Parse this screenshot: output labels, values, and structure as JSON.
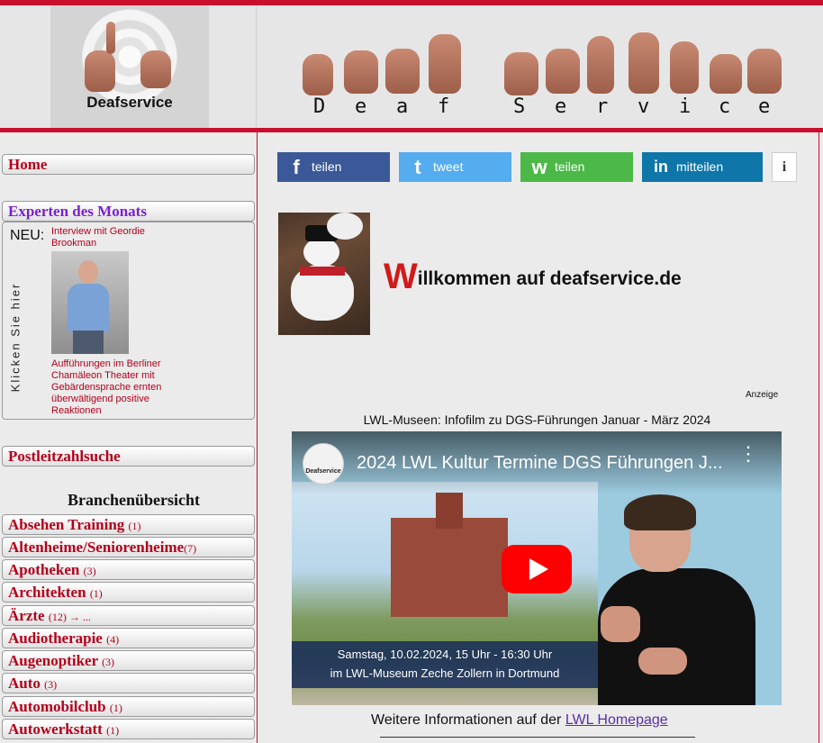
{
  "header": {
    "logo_text": "Deafservice",
    "banner_letters": [
      "D",
      "e",
      "a",
      "f",
      "S",
      "e",
      "r",
      "v",
      "i",
      "c",
      "e"
    ]
  },
  "sidebar": {
    "home": "Home",
    "experten": "Experten des Monats",
    "neu_label": "NEU:",
    "interview": "Interview mit Geordie Brookman",
    "klicken": "Klicken Sie hier",
    "news": "Aufführungen im Berliner Chamäleon Theater mit Gebärdensprache ernten überwältigend positive Reaktionen",
    "plz": "Postleitzahlsuche",
    "branchen_title": "Branchenübersicht",
    "categories": [
      {
        "label": "Absehen Training",
        "count": "(1)"
      },
      {
        "label": "Altenheime/Seniorenheime",
        "count": "(7)"
      },
      {
        "label": "Apotheken",
        "count": "(3)"
      },
      {
        "label": "Architekten",
        "count": "(1)"
      },
      {
        "label": "Ärzte",
        "count": "(12) → ..."
      },
      {
        "label": "Audiotherapie",
        "count": "(4)"
      },
      {
        "label": "Augenoptiker",
        "count": "(3)"
      },
      {
        "label": "Auto",
        "count": "(3)"
      },
      {
        "label": "Automobilclub",
        "count": "(1)"
      },
      {
        "label": "Autowerkstatt",
        "count": "(1)"
      }
    ]
  },
  "share": {
    "facebook": {
      "icon": "f",
      "label": "teilen",
      "color": "#3b5998"
    },
    "twitter": {
      "icon": "t",
      "label": "tweet",
      "color": "#55acee"
    },
    "whatsapp": {
      "icon": "w",
      "label": "teilen",
      "color": "#4cb848"
    },
    "linkedin": {
      "icon": "in",
      "label": "mitteilen",
      "color": "#0e76a8"
    },
    "info": "i"
  },
  "main": {
    "welcome_first": "W",
    "welcome_rest": "illkommen auf deafservice.de",
    "anzeige": "Anzeige",
    "video_title": "LWL-Museen: Infofilm zu DGS-Führungen Januar - März 2024",
    "video": {
      "channel": "Deafservice",
      "heading": "2024 LWL Kultur Termine DGS Führungen J...",
      "caption_line1": "Samstag, 10.02.2024, 15 Uhr - 16:30 Uhr",
      "caption_line2": "im LWL-Museum Zeche Zollern in Dortmund"
    },
    "more_info_text": "Weitere Informationen auf der ",
    "more_info_link": "LWL Homepage"
  },
  "colors": {
    "accent_red": "#c8102e",
    "category_red": "#b3001b",
    "experten_purple": "#7a1fd1",
    "link_purple": "#5a2ea6"
  }
}
